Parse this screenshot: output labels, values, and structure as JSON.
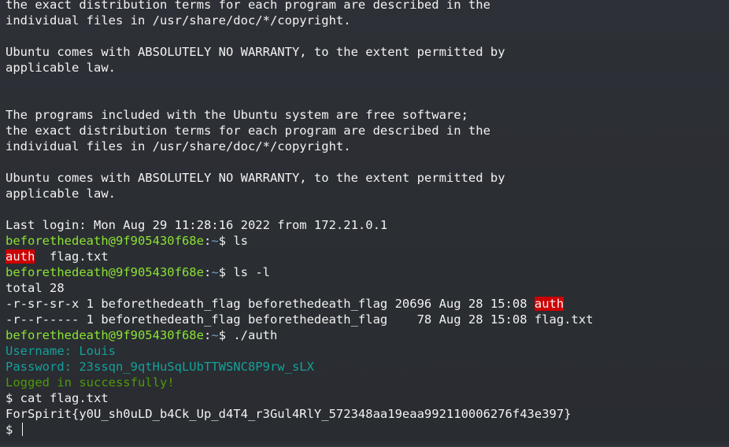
{
  "terminal": {
    "colors": {
      "background": "#2b2e33",
      "foreground": "#f2f2f2",
      "prompt_user": "#8ae234",
      "prompt_path": "#729fcf",
      "cyan_text": "#15a09a",
      "green_text": "#4e9a06",
      "exec_highlight": "#cc0000"
    },
    "motd1": {
      "line1": "the exact distribution terms for each program are described in the",
      "line2": "individual files in /usr/share/doc/*/copyright.",
      "line3": "Ubuntu comes with ABSOLUTELY NO WARRANTY, to the extent permitted by",
      "line4": "applicable law."
    },
    "motd2": {
      "line1": "The programs included with the Ubuntu system are free software;",
      "line2": "the exact distribution terms for each program are described in the",
      "line3": "individual files in /usr/share/doc/*/copyright.",
      "line4": "Ubuntu comes with ABSOLUTELY NO WARRANTY, to the extent permitted by",
      "line5": "applicable law."
    },
    "last_login": "Last login: Mon Aug 29 11:28:16 2022 from 172.21.0.1",
    "prompt": {
      "user_host": "beforethedeath@9f905430f68e",
      "sep": ":",
      "path": "~",
      "symbol": "$ "
    },
    "cmd_ls": "ls",
    "ls_output": {
      "exec_file": "auth",
      "gap": "  ",
      "file": "flag.txt"
    },
    "cmd_ls_l": "ls -l",
    "total": "total 28",
    "row1": {
      "meta": "-r-sr-sr-x 1 beforethedeath_flag beforethedeath_flag 20696 Aug 28 15:08 ",
      "name": "auth"
    },
    "row2": {
      "meta": "-r--r----- 1 beforethedeath_flag beforethedeath_flag    78 Aug 28 15:08 ",
      "name": "flag.txt"
    },
    "cmd_auth": "./auth",
    "auth_output": {
      "username": "Username: Louis",
      "password": "Password: 23ssqn_9qtHuSqLUbTTWSNC8P9rw_sLX",
      "success": "Logged in successfully!"
    },
    "shell_symbol": "$ ",
    "cmd_cat": "cat flag.txt",
    "flag": "ForSpirit{y0U_sh0uLD_b4Ck_Up_d4T4_r3Gul4RlY_572348aa19eaa992110006276f43e397}"
  }
}
